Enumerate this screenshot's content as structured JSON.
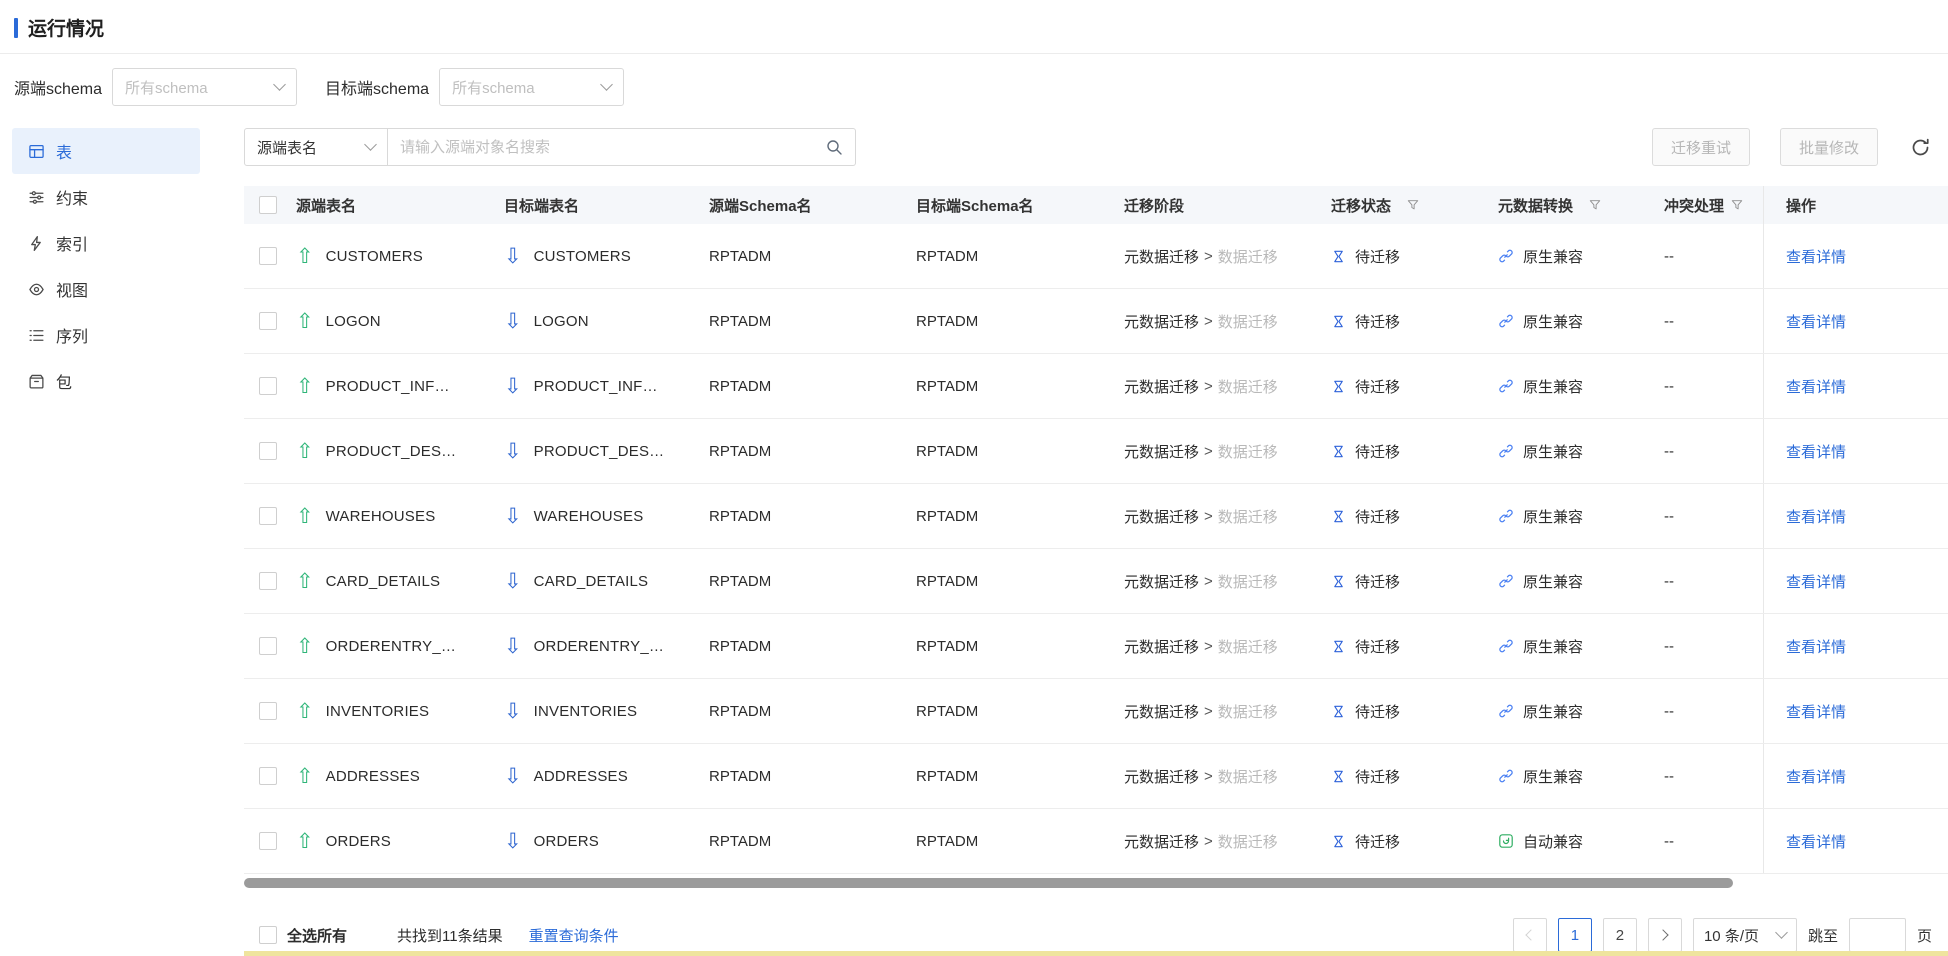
{
  "colors": {
    "accent_blue": "#2b6bd8",
    "link_blue": "#2b6bd8",
    "source_arrow_green": "#2eb578",
    "target_arrow_blue": "#2f66d0",
    "auto_compat_green": "#2fae62",
    "sidebar_active_bg": "#e9f1fc",
    "table_header_bg": "#f5f7fa",
    "bottom_strip_yellow": "#efe49e"
  },
  "page": {
    "title": "运行情况"
  },
  "filters": {
    "source_schema_label": "源端schema",
    "source_schema_value": "所有schema",
    "target_schema_label": "目标端schema",
    "target_schema_value": "所有schema"
  },
  "sidebar": {
    "items": [
      {
        "label": "表",
        "active": true
      },
      {
        "label": "约束",
        "active": false
      },
      {
        "label": "索引",
        "active": false
      },
      {
        "label": "视图",
        "active": false
      },
      {
        "label": "序列",
        "active": false
      },
      {
        "label": "包",
        "active": false
      }
    ]
  },
  "toolbar": {
    "search_type_value": "源端表名",
    "search_placeholder": "请输入源端对象名搜索",
    "retry_button": "迁移重试",
    "batch_edit_button": "批量修改"
  },
  "table": {
    "columns": [
      "源端表名",
      "目标端表名",
      "源端Schema名",
      "目标端Schema名",
      "迁移阶段",
      "迁移状态",
      "元数据转换",
      "冲突处理",
      "操作"
    ],
    "phase_separator": ">",
    "rows": [
      {
        "source": "CUSTOMERS",
        "target": "CUSTOMERS",
        "source_schema": "RPTADM",
        "target_schema": "RPTADM",
        "phase_current": "元数据迁移",
        "phase_next": "数据迁移",
        "status": "待迁移",
        "metadata": "原生兼容",
        "metadata_kind": "native",
        "conflict": "--",
        "action": "查看详情"
      },
      {
        "source": "LOGON",
        "target": "LOGON",
        "source_schema": "RPTADM",
        "target_schema": "RPTADM",
        "phase_current": "元数据迁移",
        "phase_next": "数据迁移",
        "status": "待迁移",
        "metadata": "原生兼容",
        "metadata_kind": "native",
        "conflict": "--",
        "action": "查看详情"
      },
      {
        "source": "PRODUCT_INF…",
        "target": "PRODUCT_INF…",
        "source_schema": "RPTADM",
        "target_schema": "RPTADM",
        "phase_current": "元数据迁移",
        "phase_next": "数据迁移",
        "status": "待迁移",
        "metadata": "原生兼容",
        "metadata_kind": "native",
        "conflict": "--",
        "action": "查看详情"
      },
      {
        "source": "PRODUCT_DES…",
        "target": "PRODUCT_DES…",
        "source_schema": "RPTADM",
        "target_schema": "RPTADM",
        "phase_current": "元数据迁移",
        "phase_next": "数据迁移",
        "status": "待迁移",
        "metadata": "原生兼容",
        "metadata_kind": "native",
        "conflict": "--",
        "action": "查看详情"
      },
      {
        "source": "WAREHOUSES",
        "target": "WAREHOUSES",
        "source_schema": "RPTADM",
        "target_schema": "RPTADM",
        "phase_current": "元数据迁移",
        "phase_next": "数据迁移",
        "status": "待迁移",
        "metadata": "原生兼容",
        "metadata_kind": "native",
        "conflict": "--",
        "action": "查看详情"
      },
      {
        "source": "CARD_DETAILS",
        "target": "CARD_DETAILS",
        "source_schema": "RPTADM",
        "target_schema": "RPTADM",
        "phase_current": "元数据迁移",
        "phase_next": "数据迁移",
        "status": "待迁移",
        "metadata": "原生兼容",
        "metadata_kind": "native",
        "conflict": "--",
        "action": "查看详情"
      },
      {
        "source": "ORDERENTRY_…",
        "target": "ORDERENTRY_…",
        "source_schema": "RPTADM",
        "target_schema": "RPTADM",
        "phase_current": "元数据迁移",
        "phase_next": "数据迁移",
        "status": "待迁移",
        "metadata": "原生兼容",
        "metadata_kind": "native",
        "conflict": "--",
        "action": "查看详情"
      },
      {
        "source": "INVENTORIES",
        "target": "INVENTORIES",
        "source_schema": "RPTADM",
        "target_schema": "RPTADM",
        "phase_current": "元数据迁移",
        "phase_next": "数据迁移",
        "status": "待迁移",
        "metadata": "原生兼容",
        "metadata_kind": "native",
        "conflict": "--",
        "action": "查看详情"
      },
      {
        "source": "ADDRESSES",
        "target": "ADDRESSES",
        "source_schema": "RPTADM",
        "target_schema": "RPTADM",
        "phase_current": "元数据迁移",
        "phase_next": "数据迁移",
        "status": "待迁移",
        "metadata": "原生兼容",
        "metadata_kind": "native",
        "conflict": "--",
        "action": "查看详情"
      },
      {
        "source": "ORDERS",
        "target": "ORDERS",
        "source_schema": "RPTADM",
        "target_schema": "RPTADM",
        "phase_current": "元数据迁移",
        "phase_next": "数据迁移",
        "status": "待迁移",
        "metadata": "自动兼容",
        "metadata_kind": "auto",
        "conflict": "--",
        "action": "查看详情"
      }
    ]
  },
  "footer": {
    "select_all_label": "全选所有",
    "result_count": "共找到11条结果",
    "reset_link": "重置查询条件",
    "pagination": {
      "pages": [
        "1",
        "2"
      ],
      "current_page": "1",
      "page_size": "10 条/页",
      "jump_label": "跳至",
      "page_unit": "页"
    }
  }
}
